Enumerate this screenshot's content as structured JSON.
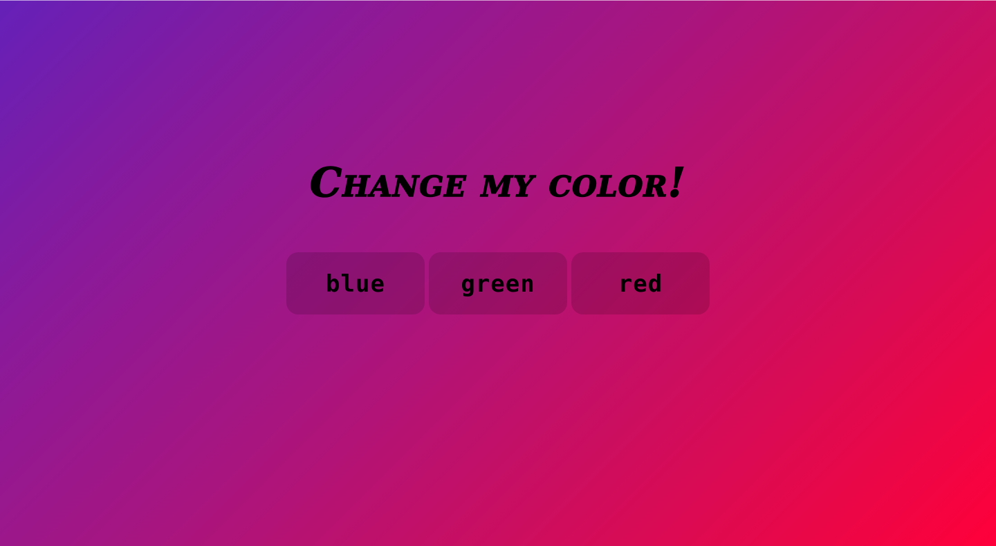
{
  "page": {
    "title": "Change my color!",
    "background_gradient_colors": [
      "#6520b8",
      "#a8157f",
      "#ff003a"
    ]
  },
  "buttons": [
    {
      "label": "blue"
    },
    {
      "label": "green"
    },
    {
      "label": "red"
    }
  ]
}
